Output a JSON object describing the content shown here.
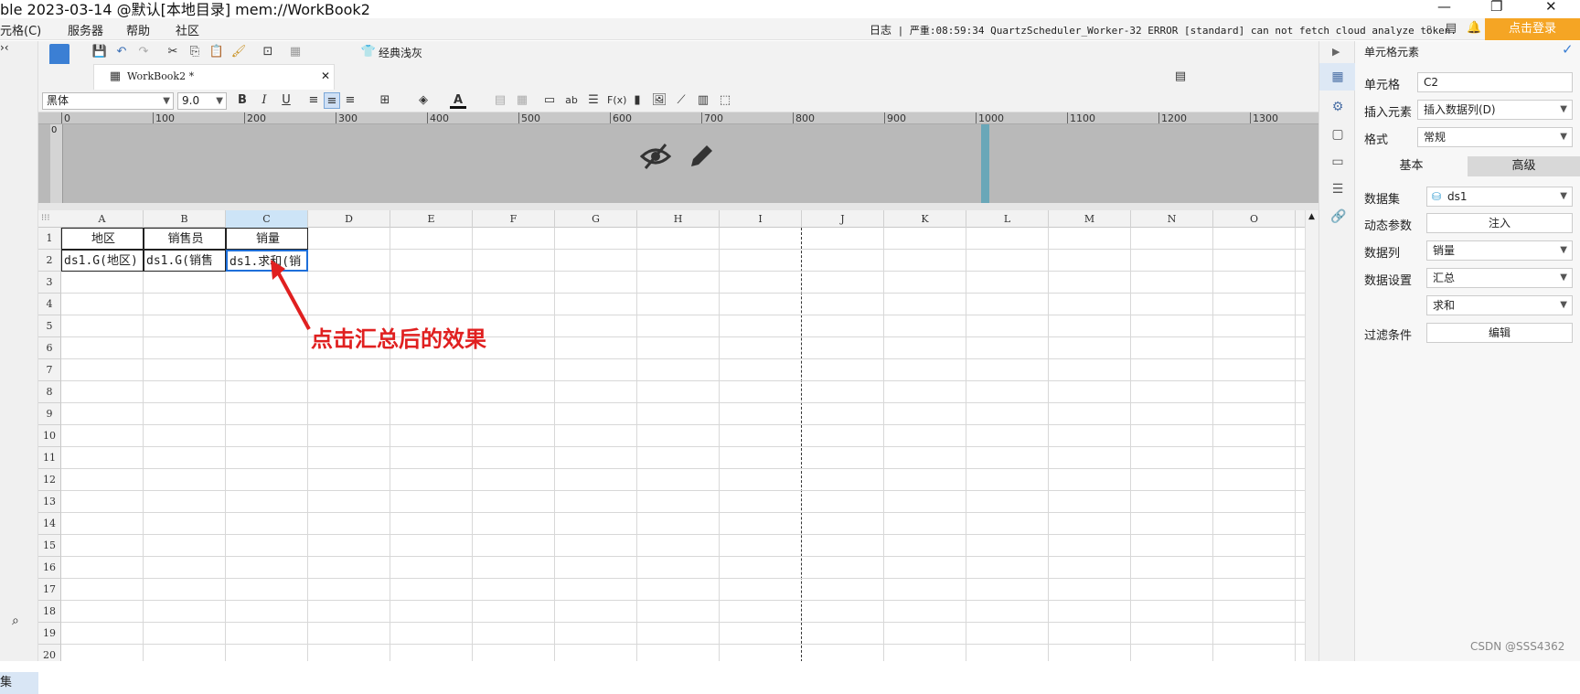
{
  "window": {
    "title": "ble 2023-03-14 @默认[本地目录]    mem://WorkBook2"
  },
  "menubar": {
    "items": [
      "元格(C)",
      "服务器",
      "帮助",
      "社区"
    ]
  },
  "status": {
    "label": "日志",
    "message": "严重:08:59:34 QuartzScheduler_Worker-32 ERROR [standard] can not fetch cloud analyze token."
  },
  "login_label": "点击登录",
  "toolbar": {
    "theme_label": "经典浅灰"
  },
  "tab": {
    "label": "WorkBook2 *"
  },
  "format": {
    "font": "黑体",
    "size": "9.0"
  },
  "ruler": {
    "marks": [
      "0",
      "100",
      "200",
      "300",
      "400",
      "500",
      "600",
      "700",
      "800",
      "900",
      "1000",
      "1100",
      "1200",
      "1300"
    ]
  },
  "sheet": {
    "columns": [
      "A",
      "B",
      "C",
      "D",
      "E",
      "F",
      "G",
      "H",
      "I",
      "J",
      "K",
      "L",
      "M",
      "N",
      "O"
    ],
    "rows": [
      "1",
      "2",
      "3",
      "4",
      "5",
      "6",
      "7",
      "8",
      "9",
      "10",
      "11",
      "12",
      "13",
      "14",
      "15",
      "16",
      "17",
      "18",
      "19",
      "20"
    ],
    "cells": {
      "A1": "地区",
      "B1": "销售员",
      "C1": "销量",
      "A2": "ds1.G(地区)",
      "B2": "ds1.G(销售",
      "C2": "ds1.求和(销"
    },
    "selected": "C2"
  },
  "annotation": "点击汇总后的效果",
  "left_panel": {
    "label": "集"
  },
  "panel": {
    "title": "单元格元素",
    "cell_label": "单元格",
    "cell_value": "C2",
    "insert_label": "插入元素",
    "insert_value": "插入数据列(D)",
    "format_label": "格式",
    "format_value": "常规",
    "tab_basic": "基本",
    "tab_advanced": "高级",
    "dataset_label": "数据集",
    "dataset_value": "ds1",
    "param_label": "动态参数",
    "param_button": "注入",
    "column_label": "数据列",
    "column_value": "销量",
    "setting_label": "数据设置",
    "setting_value": "汇总",
    "agg_value": "求和",
    "filter_label": "过滤条件",
    "filter_button": "编辑"
  },
  "watermark": "CSDN @SSS4362",
  "colors": {
    "accent": "#f5a524",
    "selection": "#1e6fd9",
    "annotation": "#e02020"
  }
}
